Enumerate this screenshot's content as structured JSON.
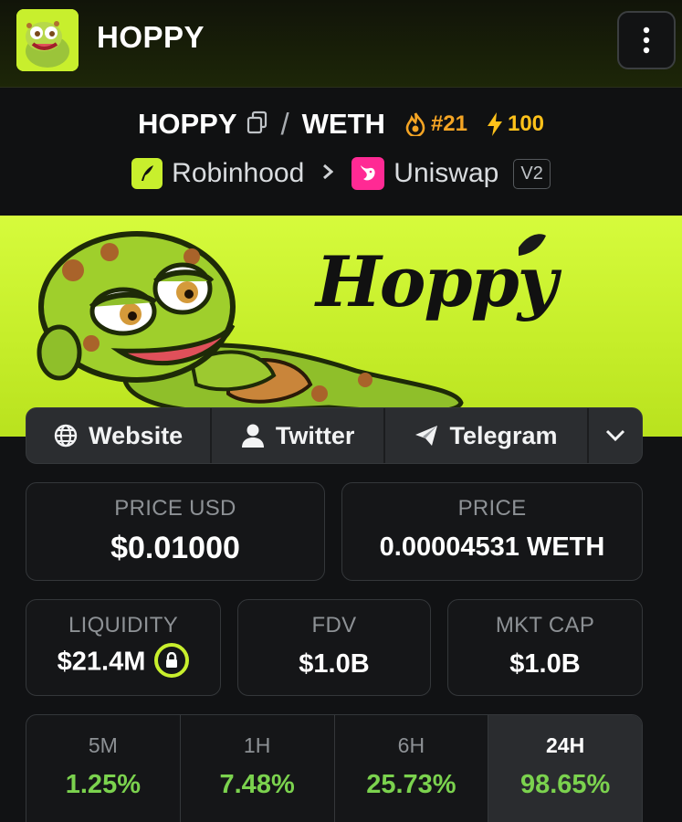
{
  "app": {
    "title": "HOPPY"
  },
  "pair": {
    "base": "HOPPY",
    "separator": "/",
    "quote": "WETH",
    "rank": "#21",
    "boosts": "100",
    "chain": "Robinhood",
    "dex": "Uniswap",
    "version": "V2"
  },
  "banner": {
    "logo_text": "Hoppy"
  },
  "links": {
    "website": "Website",
    "twitter": "Twitter",
    "telegram": "Telegram"
  },
  "stats": {
    "price_usd": {
      "label": "PRICE USD",
      "value": "$0.01000"
    },
    "price": {
      "label": "PRICE",
      "value": "0.00004531 WETH"
    },
    "liquidity": {
      "label": "LIQUIDITY",
      "value": "$21.4M"
    },
    "fdv": {
      "label": "FDV",
      "value": "$1.0B"
    },
    "mkt_cap": {
      "label": "MKT CAP",
      "value": "$1.0B"
    }
  },
  "changes": [
    {
      "period": "5M",
      "value": "1.25%"
    },
    {
      "period": "1H",
      "value": "7.48%"
    },
    {
      "period": "6H",
      "value": "25.73%"
    },
    {
      "period": "24H",
      "value": "98.65%"
    }
  ],
  "colors": {
    "accent": "#c8ef2d",
    "positive": "#7bd24e",
    "rank": "#f5a524",
    "boost": "#ffc21a",
    "background": "#111214"
  }
}
